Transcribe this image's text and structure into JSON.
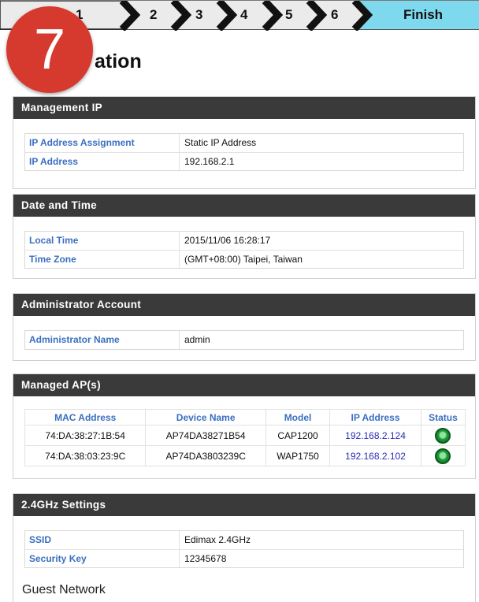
{
  "wizard": {
    "steps": [
      "1",
      "2",
      "3",
      "4",
      "5",
      "6"
    ],
    "finish_label": "Finish",
    "current_step_badge": "7",
    "colors": {
      "finish_bg": "#7ed9ee",
      "badge": "#d63a2f"
    }
  },
  "page_title_visible": "ation",
  "management_ip": {
    "header": "Management IP",
    "rows": [
      {
        "label": "IP Address Assignment",
        "value": "Static IP Address"
      },
      {
        "label": "IP Address",
        "value": "192.168.2.1"
      }
    ]
  },
  "date_time": {
    "header": "Date and Time",
    "rows": [
      {
        "label": "Local Time",
        "value": "2015/11/06  16:28:17"
      },
      {
        "label": "Time Zone",
        "value": "(GMT+08:00) Taipei, Taiwan"
      }
    ]
  },
  "admin_account": {
    "header": "Administrator Account",
    "rows": [
      {
        "label": "Administrator Name",
        "value": "admin"
      }
    ]
  },
  "managed_aps": {
    "header": "Managed AP(s)",
    "columns": [
      "MAC Address",
      "Device Name",
      "Model",
      "IP Address",
      "Status"
    ],
    "rows": [
      {
        "mac": "74:DA:38:27:1B:54",
        "name": "AP74DA38271B54",
        "model": "CAP1200",
        "ip": "192.168.2.124",
        "status": "online"
      },
      {
        "mac": "74:DA:38:03:23:9C",
        "name": "AP74DA3803239C",
        "model": "WAP1750",
        "ip": "192.168.2.102",
        "status": "online"
      }
    ]
  },
  "wifi_24": {
    "header": "2.4GHz Settings",
    "rows": [
      {
        "label": "SSID",
        "value": "Edimax 2.4GHz"
      },
      {
        "label": "Security Key",
        "value": "12345678"
      }
    ]
  },
  "guest_network_label": "Guest Network"
}
